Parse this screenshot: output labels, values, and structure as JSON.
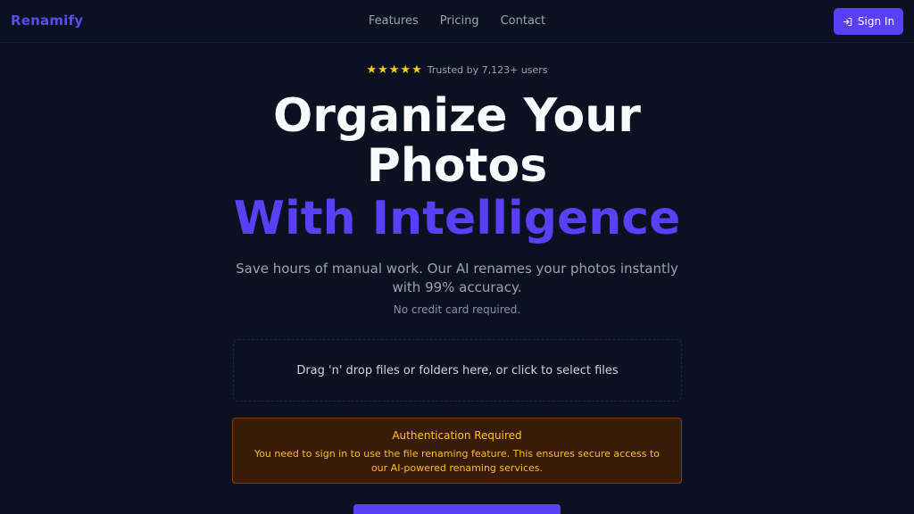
{
  "brand": {
    "name": "Renamify"
  },
  "nav": {
    "links": [
      {
        "label": "Features"
      },
      {
        "label": "Pricing"
      },
      {
        "label": "Contact"
      }
    ],
    "signin_label": "Sign In"
  },
  "hero": {
    "rating": {
      "stars": 5,
      "max": 5,
      "text": "Trusted by 7,123+ users"
    },
    "title": "Organize Your Photos",
    "title_accent": "With Intelligence",
    "subtitle": "Save hours of manual work. Our AI renames your photos instantly with 99% accuracy.",
    "note": "No credit card required."
  },
  "dropzone": {
    "label": "Drag 'n' drop files or folders here, or click to select files"
  },
  "alert": {
    "title": "Authentication Required",
    "body": "You need to sign in to use the file renaming feature. This ensures secure access to our AI-powered renaming services."
  },
  "colors": {
    "background": "#0b1120",
    "accent": "#5b3ff6",
    "warning_bg": "#3a1a08",
    "warning_text": "#fbbf24",
    "star": "#facc15"
  }
}
